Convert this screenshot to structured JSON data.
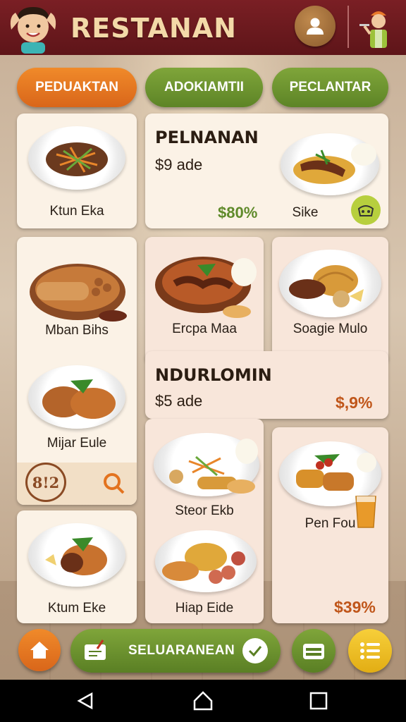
{
  "header": {
    "title": "RESTANAN",
    "avatar_icon": "woman-avatar-icon",
    "profile_icon": "user-icon",
    "waiter_icon": "waiter-icon"
  },
  "tabs": [
    {
      "label": "PEDUAKTAN",
      "color": "#e3731f"
    },
    {
      "label": "ADOKIAMTII",
      "color": "#6f962f"
    },
    {
      "label": "PECLANTAR",
      "color": "#6f962f"
    }
  ],
  "cards": {
    "kitun_eka": {
      "label": "Ktun Eka"
    },
    "featured_1": {
      "title": "PELNANAN",
      "price": "$9 ade",
      "discount": "$80%",
      "side_label": "Sike",
      "badge_icon": "rice-cooker-icon"
    },
    "mban_bihs": {
      "label": "Mban Bihs"
    },
    "ercpa_maa": {
      "label": "Ercpa Maa"
    },
    "soagie_mulo": {
      "label": "Soagie Mulo"
    },
    "mijar_eule": {
      "label": "Mijar Eule"
    },
    "rating_badge": "8!2",
    "search_icon": "search-icon",
    "featured_2": {
      "title": "NDURLOMIN",
      "price": "$5 ade",
      "discount": "$,9%"
    },
    "steor_ekb": {
      "label": "Steor Ekb"
    },
    "pen_fou": {
      "label": "Pen Fou"
    },
    "hiap_eide": {
      "label": "Hiap Eide"
    },
    "ktum_eke": {
      "label": "Ktum Eke"
    },
    "bottom_price": "$39%"
  },
  "bottom_bar": {
    "home_icon": "home-icon",
    "action_label": "SELUARANEAN",
    "action_icon": "tag-icon",
    "check_icon": "check-icon",
    "wallet_icon": "wallet-icon",
    "menu_icon": "list-icon"
  },
  "system_nav": {
    "back_icon": "back-icon",
    "home_icon": "home-outline-icon",
    "recents_icon": "recents-icon"
  },
  "colors": {
    "header": "#6d1a1f",
    "accent_orange": "#e3731f",
    "accent_green": "#6f962f",
    "accent_yellow": "#eec02a",
    "title": "#f3d9a8"
  }
}
